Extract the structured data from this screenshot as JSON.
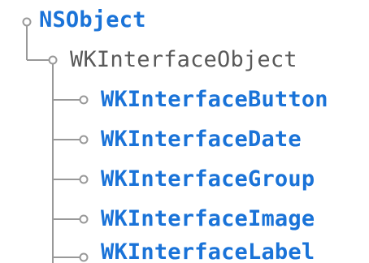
{
  "tree": {
    "root": {
      "label": "NSObject",
      "is_link": true,
      "children": [
        {
          "label": "WKInterfaceObject",
          "is_link": false,
          "children": [
            {
              "label": "WKInterfaceButton",
              "is_link": true
            },
            {
              "label": "WKInterfaceDate",
              "is_link": true
            },
            {
              "label": "WKInterfaceGroup",
              "is_link": true
            },
            {
              "label": "WKInterfaceImage",
              "is_link": true
            },
            {
              "label": "WKInterfaceLabel",
              "is_link": true,
              "partially_visible": true
            }
          ]
        }
      ]
    }
  },
  "colors": {
    "link": "#1a73d8",
    "plain": "#595959",
    "connector": "#999999",
    "node_circle": "#999999"
  }
}
